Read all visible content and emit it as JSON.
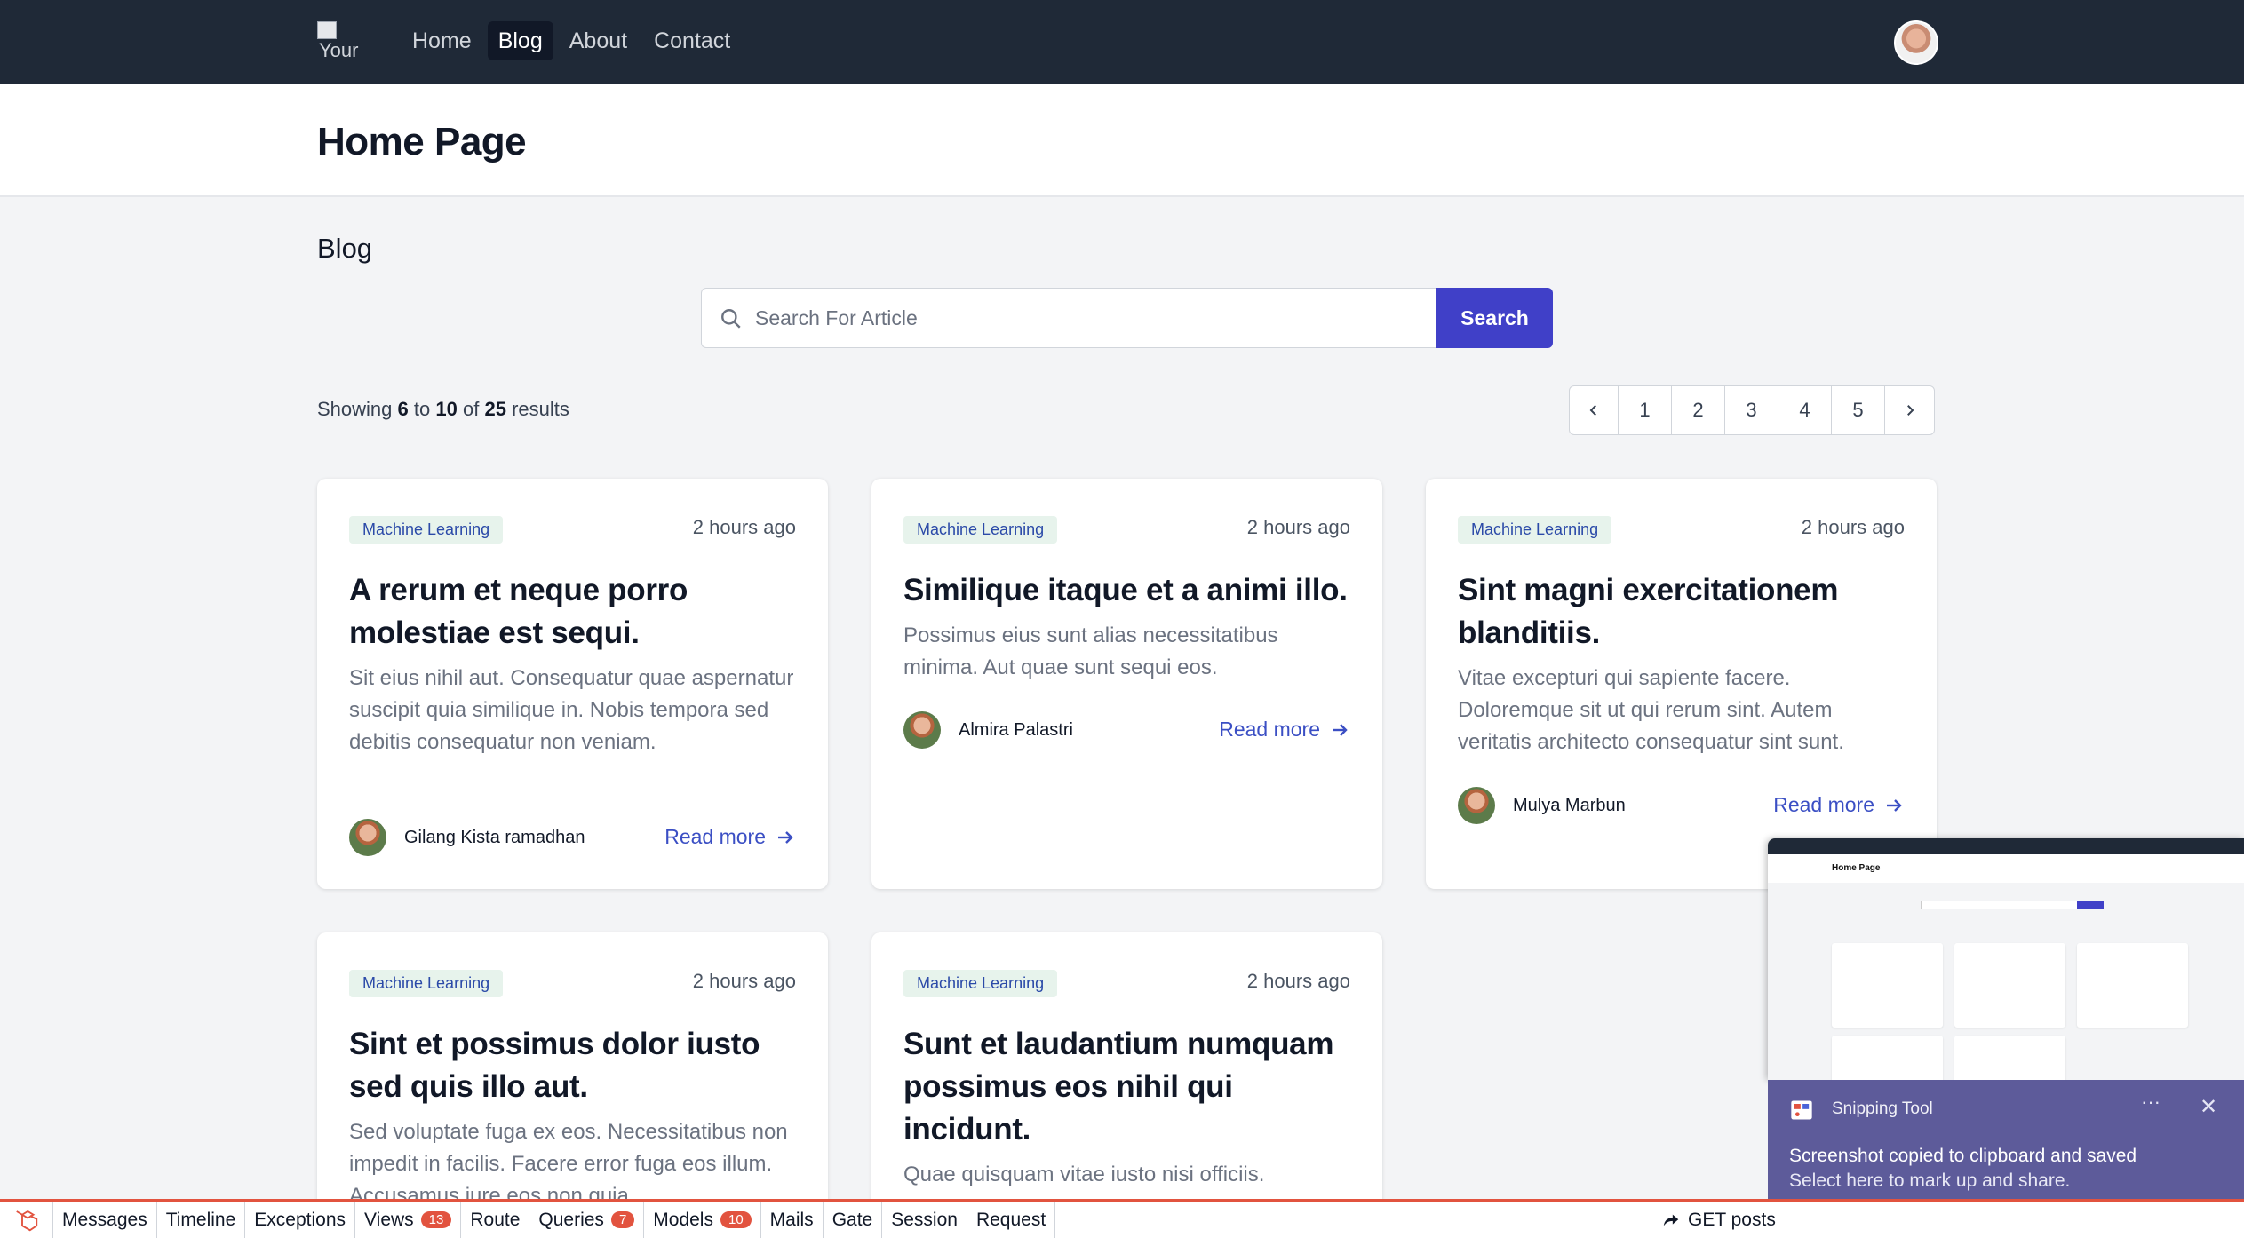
{
  "nav": {
    "logo_alt": "Your",
    "links": [
      "Home",
      "Blog",
      "About",
      "Contact"
    ]
  },
  "header": {
    "title": "Home Page"
  },
  "blog": {
    "section_title": "Blog",
    "search": {
      "placeholder": "Search For Article",
      "button": "Search"
    },
    "showing": {
      "prefix": "Showing",
      "from": "6",
      "to_word": "to",
      "to": "10",
      "of_word": "of",
      "total": "25",
      "suffix": "results"
    },
    "pagination": [
      "1",
      "2",
      "3",
      "4",
      "5"
    ],
    "read_more": "Read more",
    "posts": [
      {
        "tag": "Machine Learning",
        "time": "2 hours ago",
        "title": "A rerum et neque porro molestiae est sequi.",
        "excerpt": "Sit eius nihil aut. Consequatur quae aspernatur suscipit quia similique in. Nobis tempora sed debitis consequatur non veniam.",
        "author": "Gilang Kista ramadhan"
      },
      {
        "tag": "Machine Learning",
        "time": "2 hours ago",
        "title": "Similique itaque et a animi illo.",
        "excerpt": "Possimus eius sunt alias necessitatibus minima. Aut quae sunt sequi eos.",
        "author": "Almira Palastri"
      },
      {
        "tag": "Machine Learning",
        "time": "2 hours ago",
        "title": "Sint magni exercitationem blanditiis.",
        "excerpt": "Vitae excepturi qui sapiente facere. Doloremque sit ut qui rerum sint. Autem veritatis architecto consequatur sint sunt.",
        "author": "Mulya Marbun"
      },
      {
        "tag": "Machine Learning",
        "time": "2 hours ago",
        "title": "Sint et possimus dolor iusto sed quis illo aut.",
        "excerpt": "Sed voluptate fuga ex eos. Necessitatibus non impedit in facilis. Facere error fuga eos illum. Accusamus iure eos non quia."
      },
      {
        "tag": "Machine Learning",
        "time": "2 hours ago",
        "title": "Sunt et laudantium numquam possimus eos nihil qui incidunt.",
        "excerpt": "Quae quisquam vitae iusto nisi officiis."
      }
    ]
  },
  "snipping_tool": {
    "app_name": "Snipping Tool",
    "more": "···",
    "line1": "Screenshot copied to clipboard and saved",
    "line2": "Select here to mark up and share.",
    "thumb_title": "Home Page"
  },
  "debugbar": {
    "items": [
      {
        "label": "Messages"
      },
      {
        "label": "Timeline"
      },
      {
        "label": "Exceptions"
      },
      {
        "label": "Views",
        "badge": "13"
      },
      {
        "label": "Route"
      },
      {
        "label": "Queries",
        "badge": "7"
      },
      {
        "label": "Models",
        "badge": "10"
      },
      {
        "label": "Mails"
      },
      {
        "label": "Gate"
      },
      {
        "label": "Session"
      },
      {
        "label": "Request"
      }
    ],
    "request_method": "GET posts"
  },
  "colors": {
    "nav_bg": "#1f2937",
    "accent": "#4040c8",
    "debug_accent": "#e2533f",
    "toast_bg": "#5d5b9a"
  }
}
